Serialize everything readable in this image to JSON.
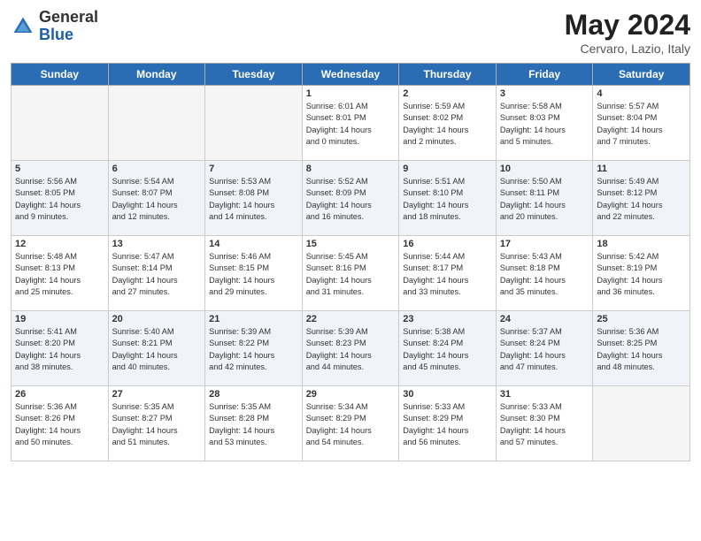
{
  "header": {
    "logo_line1": "General",
    "logo_line2": "Blue",
    "month": "May 2024",
    "location": "Cervaro, Lazio, Italy"
  },
  "days_of_week": [
    "Sunday",
    "Monday",
    "Tuesday",
    "Wednesday",
    "Thursday",
    "Friday",
    "Saturday"
  ],
  "weeks": [
    [
      {
        "num": "",
        "info": ""
      },
      {
        "num": "",
        "info": ""
      },
      {
        "num": "",
        "info": ""
      },
      {
        "num": "1",
        "info": "Sunrise: 6:01 AM\nSunset: 8:01 PM\nDaylight: 14 hours\nand 0 minutes."
      },
      {
        "num": "2",
        "info": "Sunrise: 5:59 AM\nSunset: 8:02 PM\nDaylight: 14 hours\nand 2 minutes."
      },
      {
        "num": "3",
        "info": "Sunrise: 5:58 AM\nSunset: 8:03 PM\nDaylight: 14 hours\nand 5 minutes."
      },
      {
        "num": "4",
        "info": "Sunrise: 5:57 AM\nSunset: 8:04 PM\nDaylight: 14 hours\nand 7 minutes."
      }
    ],
    [
      {
        "num": "5",
        "info": "Sunrise: 5:56 AM\nSunset: 8:05 PM\nDaylight: 14 hours\nand 9 minutes."
      },
      {
        "num": "6",
        "info": "Sunrise: 5:54 AM\nSunset: 8:07 PM\nDaylight: 14 hours\nand 12 minutes."
      },
      {
        "num": "7",
        "info": "Sunrise: 5:53 AM\nSunset: 8:08 PM\nDaylight: 14 hours\nand 14 minutes."
      },
      {
        "num": "8",
        "info": "Sunrise: 5:52 AM\nSunset: 8:09 PM\nDaylight: 14 hours\nand 16 minutes."
      },
      {
        "num": "9",
        "info": "Sunrise: 5:51 AM\nSunset: 8:10 PM\nDaylight: 14 hours\nand 18 minutes."
      },
      {
        "num": "10",
        "info": "Sunrise: 5:50 AM\nSunset: 8:11 PM\nDaylight: 14 hours\nand 20 minutes."
      },
      {
        "num": "11",
        "info": "Sunrise: 5:49 AM\nSunset: 8:12 PM\nDaylight: 14 hours\nand 22 minutes."
      }
    ],
    [
      {
        "num": "12",
        "info": "Sunrise: 5:48 AM\nSunset: 8:13 PM\nDaylight: 14 hours\nand 25 minutes."
      },
      {
        "num": "13",
        "info": "Sunrise: 5:47 AM\nSunset: 8:14 PM\nDaylight: 14 hours\nand 27 minutes."
      },
      {
        "num": "14",
        "info": "Sunrise: 5:46 AM\nSunset: 8:15 PM\nDaylight: 14 hours\nand 29 minutes."
      },
      {
        "num": "15",
        "info": "Sunrise: 5:45 AM\nSunset: 8:16 PM\nDaylight: 14 hours\nand 31 minutes."
      },
      {
        "num": "16",
        "info": "Sunrise: 5:44 AM\nSunset: 8:17 PM\nDaylight: 14 hours\nand 33 minutes."
      },
      {
        "num": "17",
        "info": "Sunrise: 5:43 AM\nSunset: 8:18 PM\nDaylight: 14 hours\nand 35 minutes."
      },
      {
        "num": "18",
        "info": "Sunrise: 5:42 AM\nSunset: 8:19 PM\nDaylight: 14 hours\nand 36 minutes."
      }
    ],
    [
      {
        "num": "19",
        "info": "Sunrise: 5:41 AM\nSunset: 8:20 PM\nDaylight: 14 hours\nand 38 minutes."
      },
      {
        "num": "20",
        "info": "Sunrise: 5:40 AM\nSunset: 8:21 PM\nDaylight: 14 hours\nand 40 minutes."
      },
      {
        "num": "21",
        "info": "Sunrise: 5:39 AM\nSunset: 8:22 PM\nDaylight: 14 hours\nand 42 minutes."
      },
      {
        "num": "22",
        "info": "Sunrise: 5:39 AM\nSunset: 8:23 PM\nDaylight: 14 hours\nand 44 minutes."
      },
      {
        "num": "23",
        "info": "Sunrise: 5:38 AM\nSunset: 8:24 PM\nDaylight: 14 hours\nand 45 minutes."
      },
      {
        "num": "24",
        "info": "Sunrise: 5:37 AM\nSunset: 8:24 PM\nDaylight: 14 hours\nand 47 minutes."
      },
      {
        "num": "25",
        "info": "Sunrise: 5:36 AM\nSunset: 8:25 PM\nDaylight: 14 hours\nand 48 minutes."
      }
    ],
    [
      {
        "num": "26",
        "info": "Sunrise: 5:36 AM\nSunset: 8:26 PM\nDaylight: 14 hours\nand 50 minutes."
      },
      {
        "num": "27",
        "info": "Sunrise: 5:35 AM\nSunset: 8:27 PM\nDaylight: 14 hours\nand 51 minutes."
      },
      {
        "num": "28",
        "info": "Sunrise: 5:35 AM\nSunset: 8:28 PM\nDaylight: 14 hours\nand 53 minutes."
      },
      {
        "num": "29",
        "info": "Sunrise: 5:34 AM\nSunset: 8:29 PM\nDaylight: 14 hours\nand 54 minutes."
      },
      {
        "num": "30",
        "info": "Sunrise: 5:33 AM\nSunset: 8:29 PM\nDaylight: 14 hours\nand 56 minutes."
      },
      {
        "num": "31",
        "info": "Sunrise: 5:33 AM\nSunset: 8:30 PM\nDaylight: 14 hours\nand 57 minutes."
      },
      {
        "num": "",
        "info": ""
      }
    ]
  ]
}
